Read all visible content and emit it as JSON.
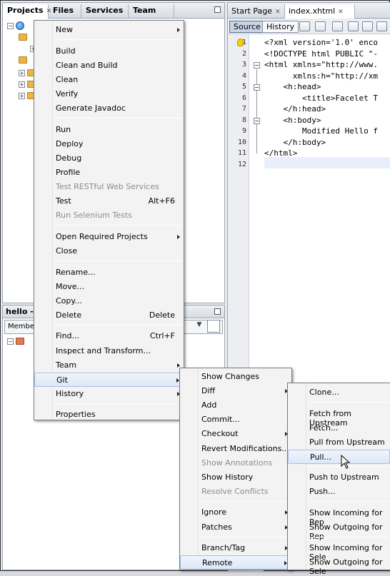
{
  "projects_panel": {
    "tabs": [
      "Projects",
      "Files",
      "Services",
      "Team"
    ]
  },
  "navigator": {
    "title": "hello - N",
    "members_label": "Members"
  },
  "editor": {
    "tabs": [
      "Start Page",
      "index.xhtml"
    ],
    "source_btn": "Source",
    "history_btn": "History",
    "line_numbers": [
      "1",
      "2",
      "3",
      "4",
      "5",
      "6",
      "7",
      "8",
      "9",
      "10",
      "11",
      "12"
    ],
    "lines": [
      "<?xml version='1.0' enco",
      "<!DOCTYPE html PUBLIC \"-",
      "<html xmlns=\"http://www.",
      "      xmlns:h=\"http://xm",
      "    <h:head>",
      "        <title>Facelet T",
      "    </h:head>",
      "    <h:body>",
      "        Modified Hello f",
      "    </h:body>",
      "</html>",
      ""
    ]
  },
  "context_menu": {
    "items": [
      {
        "label": "New",
        "submenu": true
      },
      {
        "sep": true
      },
      {
        "label": "Build"
      },
      {
        "label": "Clean and Build"
      },
      {
        "label": "Clean"
      },
      {
        "label": "Verify"
      },
      {
        "label": "Generate Javadoc"
      },
      {
        "sep": true
      },
      {
        "label": "Run"
      },
      {
        "label": "Deploy"
      },
      {
        "label": "Debug"
      },
      {
        "label": "Profile"
      },
      {
        "label": "Test RESTful Web Services",
        "disabled": true
      },
      {
        "label": "Test",
        "shortcut": "Alt+F6"
      },
      {
        "label": "Run Selenium Tests",
        "disabled": true
      },
      {
        "sep": true
      },
      {
        "label": "Open Required Projects",
        "submenu": true
      },
      {
        "label": "Close"
      },
      {
        "sep": true
      },
      {
        "label": "Rename..."
      },
      {
        "label": "Move..."
      },
      {
        "label": "Copy..."
      },
      {
        "label": "Delete",
        "shortcut": "Delete"
      },
      {
        "sep": true
      },
      {
        "label": "Find...",
        "shortcut": "Ctrl+F"
      },
      {
        "label": "Inspect and Transform..."
      },
      {
        "label": "Team",
        "submenu": true
      },
      {
        "label": "Git",
        "submenu": true,
        "highlight": true
      },
      {
        "label": "History",
        "submenu": true
      },
      {
        "sep": true
      },
      {
        "label": "Properties"
      }
    ]
  },
  "git_menu": {
    "items": [
      {
        "label": "Show Changes"
      },
      {
        "label": "Diff",
        "submenu": true
      },
      {
        "label": "Add"
      },
      {
        "label": "Commit..."
      },
      {
        "label": "Checkout",
        "submenu": true
      },
      {
        "label": "Revert Modifications..."
      },
      {
        "label": "Show Annotations",
        "disabled": true
      },
      {
        "label": "Show History"
      },
      {
        "label": "Resolve Conflicts",
        "disabled": true
      },
      {
        "sep": true
      },
      {
        "label": "Ignore",
        "submenu": true
      },
      {
        "label": "Patches",
        "submenu": true
      },
      {
        "sep": true
      },
      {
        "label": "Branch/Tag",
        "submenu": true
      },
      {
        "label": "Remote",
        "submenu": true,
        "highlight": true
      }
    ]
  },
  "remote_menu": {
    "items": [
      {
        "label": "Clone..."
      },
      {
        "sep": true
      },
      {
        "label": "Fetch from Upstream"
      },
      {
        "label": "Fetch..."
      },
      {
        "label": "Pull from Upstream"
      },
      {
        "label": "Pull...",
        "highlight": true
      },
      {
        "sep": true
      },
      {
        "label": "Push to Upstream"
      },
      {
        "label": "Push..."
      },
      {
        "sep": true
      },
      {
        "label": "Show Incoming for Rep"
      },
      {
        "label": "Show Outgoing for Rep"
      },
      {
        "sep": true
      },
      {
        "label": "Show Incoming for Sele"
      },
      {
        "label": "Show Outgoing for Sele"
      }
    ]
  }
}
